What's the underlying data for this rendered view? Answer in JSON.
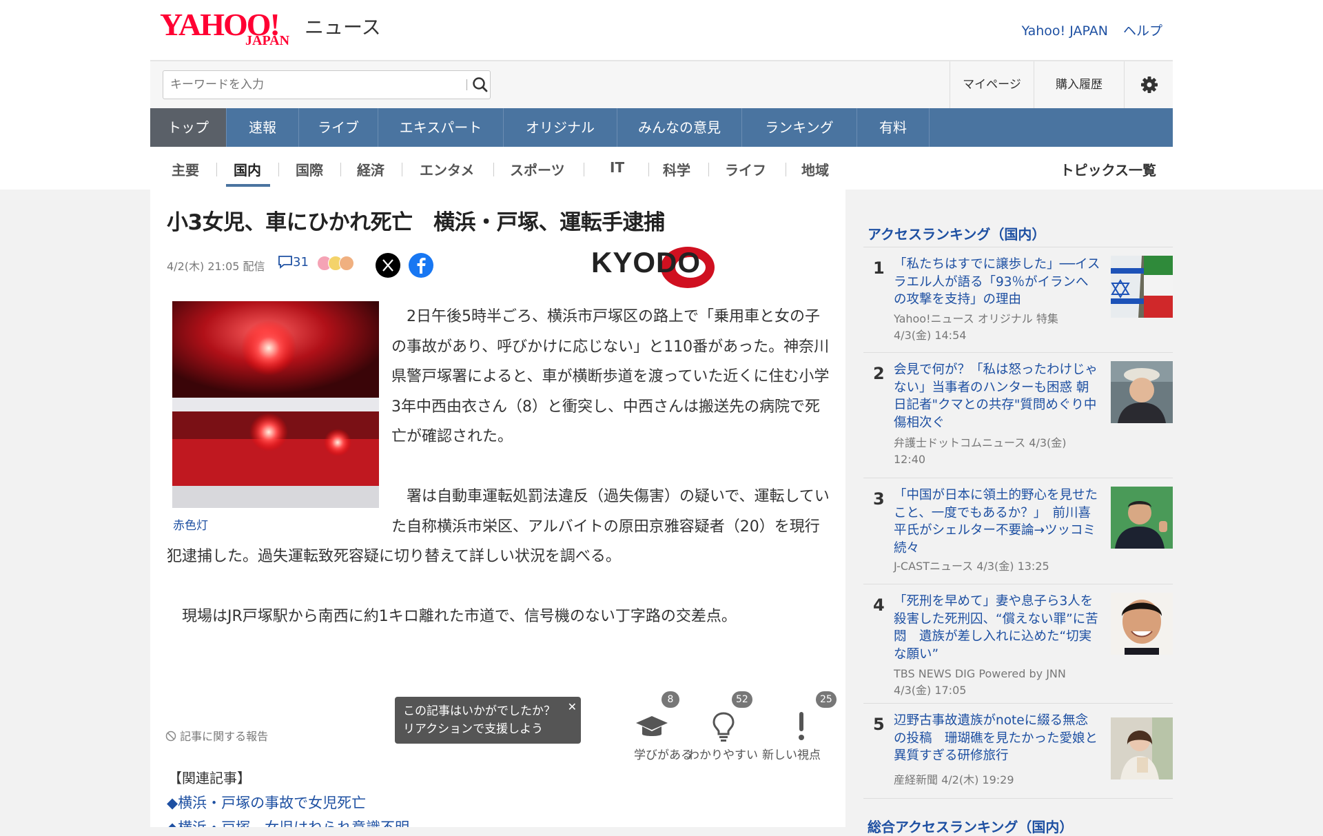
{
  "header": {
    "logo_text": "YAHOO!",
    "logo_sub": "JAPAN",
    "service_name": "ニュース",
    "links": [
      "Yahoo! JAPAN",
      "ヘルプ"
    ]
  },
  "search": {
    "placeholder": "キーワードを入力",
    "mypage": "マイページ",
    "history": "購入履歴"
  },
  "global_nav": [
    "トップ",
    "速報",
    "ライブ",
    "エキスパート",
    "オリジナル",
    "みんなの意見",
    "ランキング",
    "有料"
  ],
  "sub_nav": {
    "items": [
      "主要",
      "国内",
      "国際",
      "経済",
      "エンタメ",
      "スポーツ",
      "IT",
      "科学",
      "ライフ",
      "地域"
    ],
    "active": "国内",
    "topics": "トピックス一覧"
  },
  "article": {
    "title": "小3女児、車にひかれ死亡　横浜・戸塚、運転手逮捕",
    "date": "4/2(木) 21:05 配信",
    "comment_count": "31",
    "publisher": "KYODO",
    "photo_caption": "赤色灯",
    "paragraphs": [
      "　2日午後5時半ごろ、横浜市戸塚区の路上で「乗用車と女の子の事故があり、呼びかけに応じない」と110番があった。神奈川県警戸塚署によると、車が横断歩道を渡っていた近くに住む小学3年中西由衣さん（8）と衝突し、中西さんは搬送先の病院で死亡が確認された。",
      "　署は自動車運転処罰法違反（過失傷害）の疑いで、運転していた自称横浜市栄区、アルバイトの原田京雅容疑者（20）を現行犯逮捕した。過失運転致死容疑に切り替えて詳しい状況を調べる。",
      "　現場はJR戸塚駅から南西に約1キロ離れた市道で、信号機のない丁字路の交差点。"
    ],
    "report_link": "記事に関する報告",
    "tooltip": [
      "この記事はいかがでしたか？",
      "リアクションで支援しよう"
    ],
    "reactions": [
      {
        "label": "学びがある",
        "count": "8"
      },
      {
        "label": "わかりやすい",
        "count": "52"
      },
      {
        "label": "新しい視点",
        "count": "25"
      }
    ],
    "related_heading": "【関連記事】",
    "related": [
      "◆横浜・戸塚の事故で女児死亡",
      "◆横浜・戸塚、女児はねられ意識不明"
    ]
  },
  "ranking": {
    "title": "アクセスランキング（国内）",
    "items": [
      {
        "rank": "1",
        "title": "「私たちはすでに譲歩した」──イスラエル人が語る「93％がイランへの攻撃を支持」の理由",
        "source": "Yahoo!ニュース オリジナル 特集",
        "time": "4/3(金) 14:54"
      },
      {
        "rank": "2",
        "title": "会見で何が？「私は怒ったわけじゃない」当事者のハンターも困惑 朝日記者\"クマとの共存\"質問めぐり中傷相次ぐ",
        "source": "弁護士ドットコムニュース 4/3(金)",
        "time": "12:40"
      },
      {
        "rank": "3",
        "title": "「中国が日本に領土的野心を見せたこと、一度でもあるか？」　前川喜平氏がシェルター不要論→ツッコミ続々",
        "source": "J-CASTニュース 4/3(金) 13:25",
        "time": ""
      },
      {
        "rank": "4",
        "title": "「死刑を早めて」妻や息子ら3人を殺害した死刑囚、“償えない罪”に苦悶　遺族が差し入れに込めた“切実な願い”",
        "source": "TBS NEWS DIG Powered by JNN",
        "time": "4/3(金) 17:05"
      },
      {
        "rank": "5",
        "title": "辺野古事故遺族がnoteに綴る無念の投稿　珊瑚礁を見たかった愛娘と異質すぎる研修旅行",
        "source": "産経新聞 4/2(木) 19:29",
        "time": ""
      }
    ],
    "next_title": "総合アクセスランキング（国内）"
  },
  "colors": {
    "brand_red": "#ff0033",
    "nav_blue": "#4a74a0",
    "link_blue": "#1e50a2"
  }
}
